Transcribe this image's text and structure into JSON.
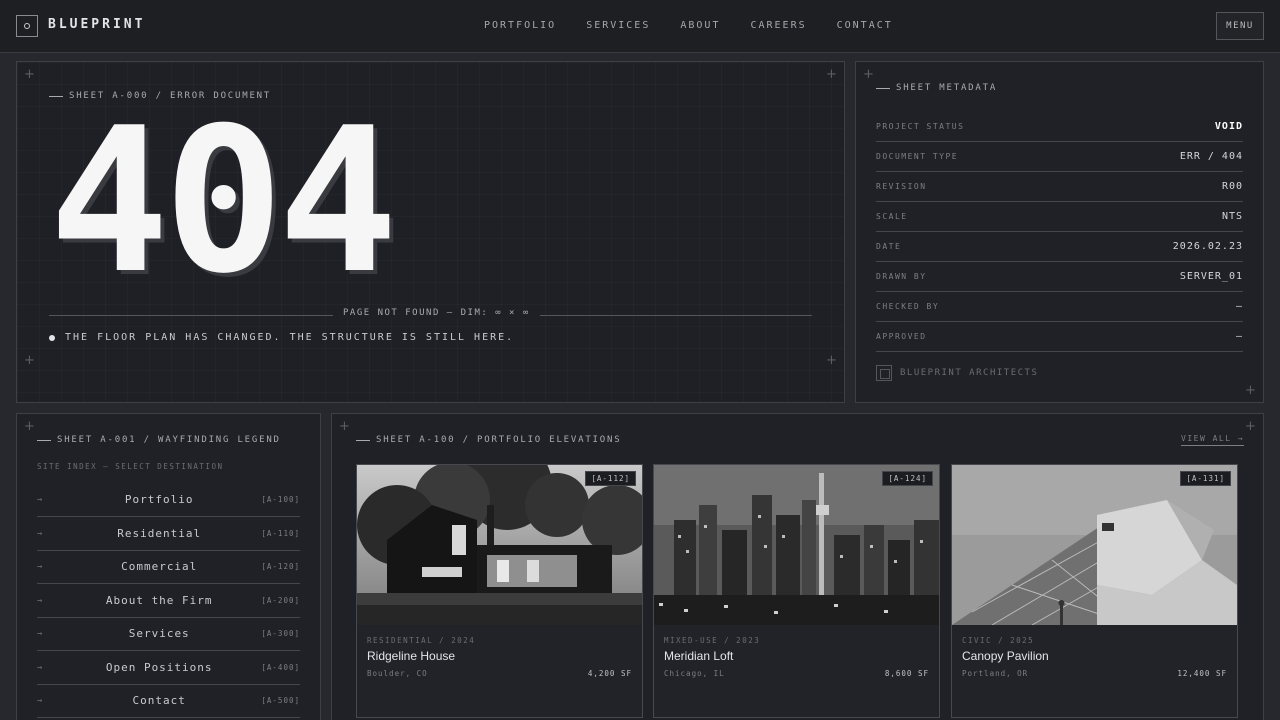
{
  "nav": {
    "brand": "BLUEPRINT",
    "links": [
      "PORTFOLIO",
      "SERVICES",
      "ABOUT",
      "CAREERS",
      "CONTACT"
    ],
    "menu_label": "MENU"
  },
  "error": {
    "sheet_label": "SHEET A-000 / ERROR DOCUMENT",
    "code": "404",
    "dimension": "PAGE NOT FOUND — DIM: ∞ × ∞",
    "message": "THE FLOOR PLAN HAS CHANGED. THE STRUCTURE IS STILL HERE."
  },
  "metadata": {
    "sheet_label": "SHEET METADATA",
    "rows": [
      {
        "key": "PROJECT STATUS",
        "value": "VOID"
      },
      {
        "key": "DOCUMENT TYPE",
        "value": "ERR / 404"
      },
      {
        "key": "REVISION",
        "value": "R00"
      },
      {
        "key": "SCALE",
        "value": "NTS"
      },
      {
        "key": "DATE",
        "value": "2026.02.23"
      },
      {
        "key": "DRAWN BY",
        "value": "SERVER_01"
      },
      {
        "key": "CHECKED BY",
        "value": "—"
      },
      {
        "key": "APPROVED",
        "value": "—"
      }
    ],
    "firm": "BLUEPRINT ARCHITECTS"
  },
  "legend": {
    "sheet_label": "SHEET A-001 / WAYFINDING LEGEND",
    "subtitle": "SITE INDEX — SELECT DESTINATION",
    "items": [
      {
        "label": "Portfolio",
        "code": "[A-100]"
      },
      {
        "label": "Residential",
        "code": "[A-110]"
      },
      {
        "label": "Commercial",
        "code": "[A-120]"
      },
      {
        "label": "About the Firm",
        "code": "[A-200]"
      },
      {
        "label": "Services",
        "code": "[A-300]"
      },
      {
        "label": "Open Positions",
        "code": "[A-400]"
      },
      {
        "label": "Contact",
        "code": "[A-500]"
      }
    ]
  },
  "portfolio": {
    "sheet_label": "SHEET A-100 / PORTFOLIO ELEVATIONS",
    "view_all": "VIEW ALL →",
    "cards": [
      {
        "tag": "[A-112]",
        "category": "RESIDENTIAL / 2024",
        "title": "Ridgeline House",
        "location": "Boulder, CO",
        "area": "4,200 SF"
      },
      {
        "tag": "[A-124]",
        "category": "MIXED-USE / 2023",
        "title": "Meridian Loft",
        "location": "Chicago, IL",
        "area": "8,600 SF"
      },
      {
        "tag": "[A-131]",
        "category": "CIVIC / 2025",
        "title": "Canopy Pavilion",
        "location": "Portland, OR",
        "area": "12,400 SF"
      }
    ]
  }
}
